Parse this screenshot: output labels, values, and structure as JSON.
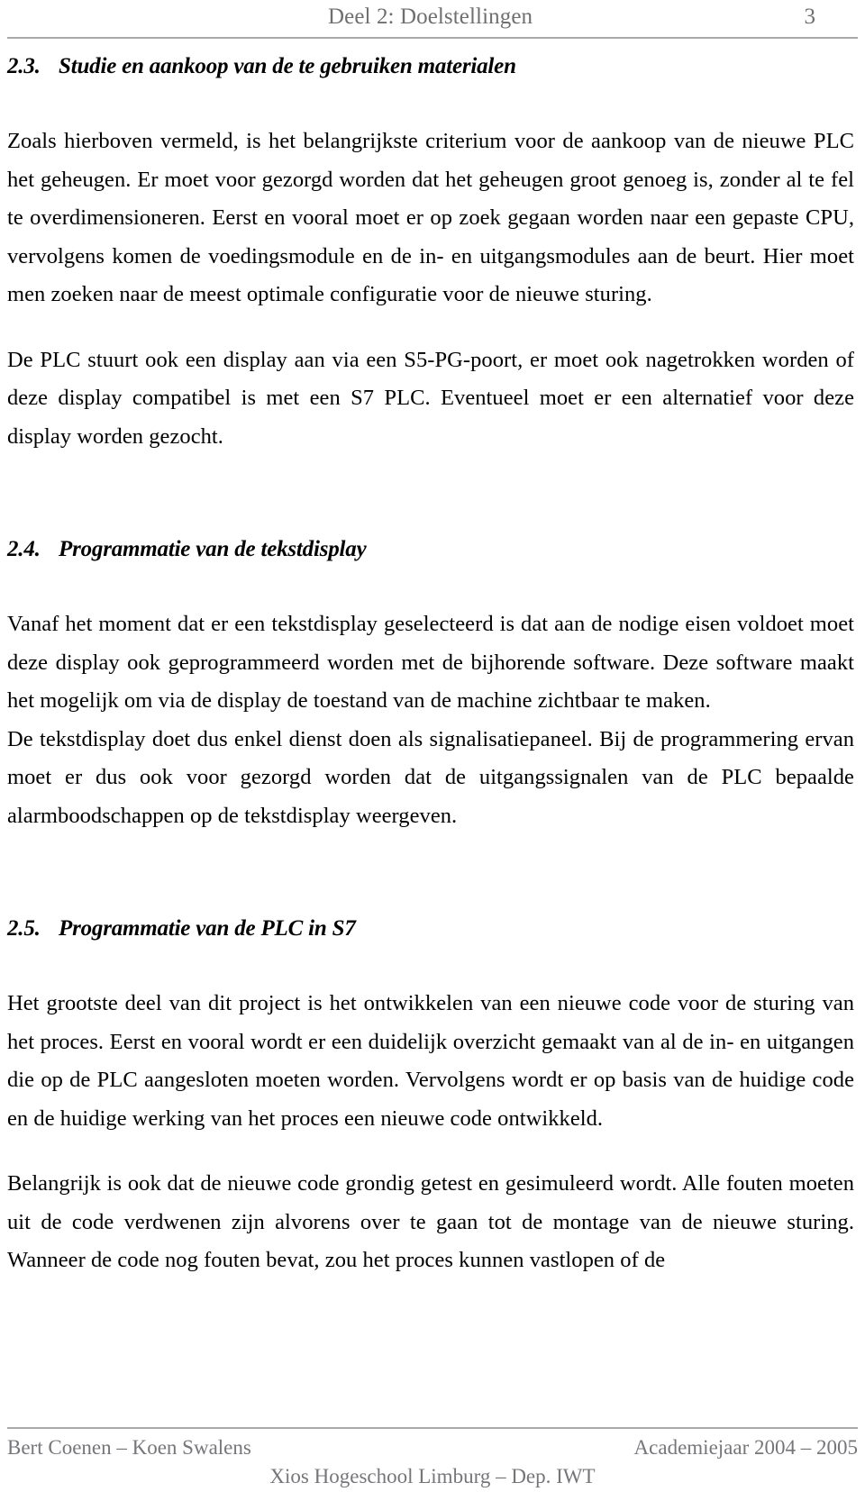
{
  "header": {
    "title": "Deel 2: Doelstellingen",
    "page_number": "3",
    "rule_color": "#a9a9ac",
    "text_color": "#6f6f70"
  },
  "sections": [
    {
      "number": "2.3.",
      "title": "Studie en aankoop van de te gebruiken materialen",
      "paragraphs": [
        "Zoals hierboven vermeld, is het belangrijkste criterium voor de aankoop van de nieuwe PLC het geheugen. Er moet voor gezorgd worden dat het geheugen groot genoeg is, zonder al te fel te overdimensioneren. Eerst en vooral moet er op zoek gegaan worden naar een gepaste CPU, vervolgens komen de voedingsmodule en de in- en uitgangsmodules aan de beurt. Hier moet men zoeken naar de meest optimale configuratie voor de nieuwe sturing.",
        "De PLC stuurt ook een display aan via een S5-PG-poort, er moet ook nagetrokken worden of deze display compatibel is met een S7 PLC. Eventueel moet er een alternatief voor deze display worden gezocht."
      ]
    },
    {
      "number": "2.4.",
      "title": "Programmatie van de tekstdisplay",
      "paragraphs": [
        "Vanaf het moment dat er een tekstdisplay geselecteerd is dat aan de nodige eisen voldoet moet deze display ook geprogrammeerd worden met de bijhorende software. Deze software maakt het mogelijk om via de display de toestand van de machine zichtbaar te maken.",
        "De tekstdisplay doet dus enkel dienst doen als signalisatiepaneel. Bij de programmering ervan moet er dus ook voor gezorgd worden dat de uitgangssignalen van de PLC bepaalde alarmboodschappen op de tekstdisplay weergeven."
      ]
    },
    {
      "number": "2.5.",
      "title": "Programmatie van de PLC in S7",
      "paragraphs": [
        "Het grootste deel van dit project is het ontwikkelen van een nieuwe code voor de sturing van het proces. Eerst en vooral wordt er een duidelijk overzicht gemaakt van al de in- en uitgangen die op de PLC aangesloten moeten worden. Vervolgens wordt er op basis van de huidige code en de huidige werking van het proces een nieuwe code ontwikkeld.",
        "Belangrijk is ook dat de nieuwe code grondig getest en gesimuleerd wordt. Alle fouten moeten uit de code verdwenen zijn alvorens over te gaan tot de montage van de nieuwe sturing. Wanneer de code nog fouten bevat, zou het proces kunnen vastlopen of de"
      ]
    }
  ],
  "footer": {
    "authors": "Bert Coenen – Koen Swalens",
    "academic_year": "Academiejaar 2004 – 2005",
    "institution": "Xios Hogeschool Limburg – Dep. IWT",
    "rule_color": "#a9a9ac",
    "text_color": "#76767a"
  }
}
